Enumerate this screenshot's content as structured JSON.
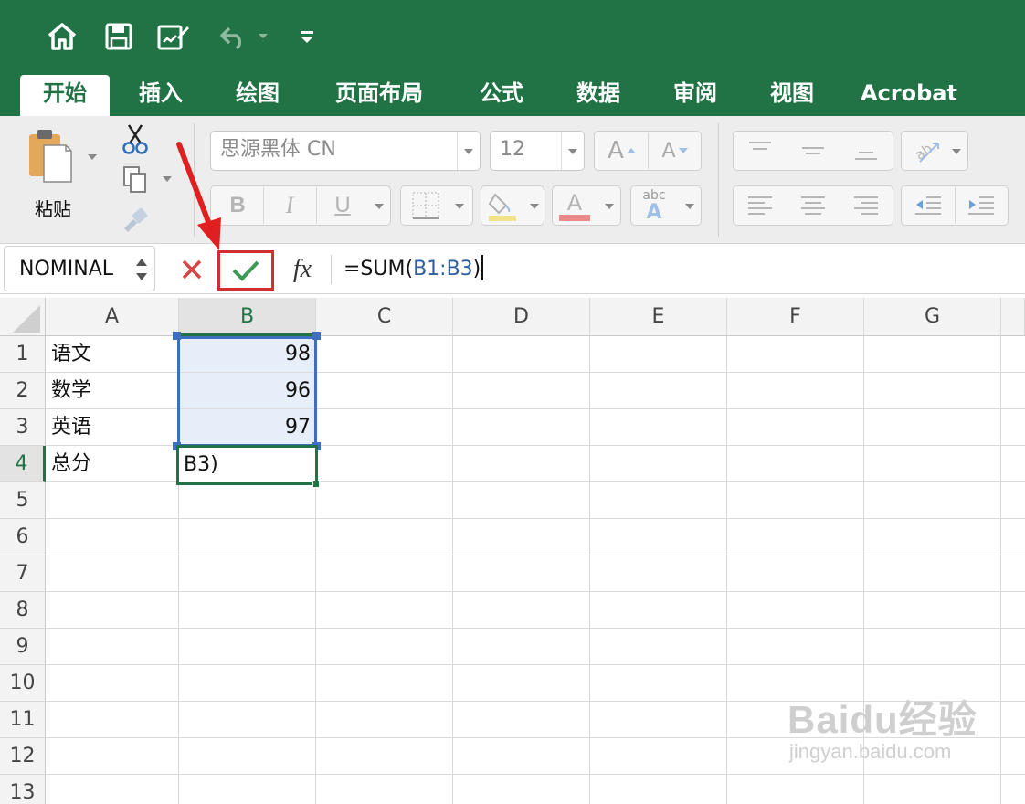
{
  "quick_access": {
    "icons": [
      "home-icon",
      "save-icon",
      "edit-icon",
      "undo-icon",
      "customize-icon"
    ]
  },
  "tabs": [
    {
      "label": "开始",
      "active": true
    },
    {
      "label": "插入"
    },
    {
      "label": "绘图"
    },
    {
      "label": "页面布局"
    },
    {
      "label": "公式"
    },
    {
      "label": "数据"
    },
    {
      "label": "审阅"
    },
    {
      "label": "视图"
    },
    {
      "label": "Acrobat"
    }
  ],
  "ribbon": {
    "paste_label": "粘贴",
    "font_name": "思源黑体 CN",
    "font_size": "12",
    "bold": "B",
    "italic": "I",
    "underline": "U",
    "grow_font": "A",
    "shrink_font": "A",
    "font_color_letter": "A",
    "phonetic_text": "abc",
    "phonetic_letter": "A"
  },
  "formula_bar": {
    "name_box": "NOMINAL",
    "fx": "fx",
    "formula_prefix": "=SUM(",
    "formula_ref": "B1:B3",
    "formula_suffix": ")"
  },
  "sheet": {
    "columns": [
      "A",
      "B",
      "C",
      "D",
      "E",
      "F",
      "G"
    ],
    "rows": [
      "1",
      "2",
      "3",
      "4",
      "5",
      "6",
      "7",
      "8",
      "9",
      "10",
      "11",
      "12",
      "13"
    ],
    "cells": {
      "A1": "语文",
      "B1": "98",
      "A2": "数学",
      "B2": "96",
      "A3": "英语",
      "B3": "97",
      "A4": "总分",
      "B4": "B3)"
    }
  },
  "watermark": {
    "brand": "Baidu经验",
    "url": "jingyan.baidu.com"
  },
  "colors": {
    "excel_green": "#217346",
    "selection_fill": "#e6eef9",
    "range_border": "#3e6fbf",
    "highlight_red": "#e02020"
  }
}
